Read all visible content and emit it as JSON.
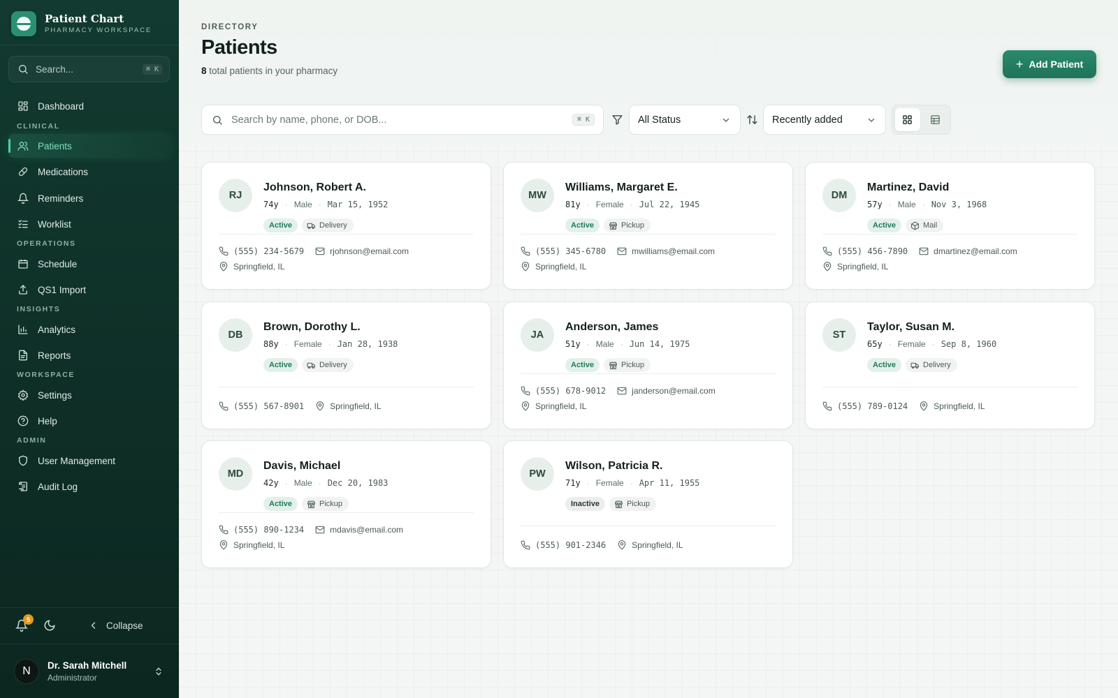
{
  "brand": {
    "title": "Patient Chart",
    "subtitle": "PHARMACY WORKSPACE"
  },
  "sidebar": {
    "search_placeholder": "Search...",
    "search_shortcut": "⌘ K",
    "sections": {
      "clinical": "CLINICAL",
      "operations": "OPERATIONS",
      "insights": "INSIGHTS",
      "workspace": "WORKSPACE",
      "admin": "ADMIN"
    },
    "items": {
      "dashboard": "Dashboard",
      "patients": "Patients",
      "medications": "Medications",
      "reminders": "Reminders",
      "worklist": "Worklist",
      "schedule": "Schedule",
      "qs1_import": "QS1 Import",
      "analytics": "Analytics",
      "reports": "Reports",
      "settings": "Settings",
      "help": "Help",
      "user_management": "User Management",
      "audit_log": "Audit Log"
    },
    "active_item": "patients",
    "notification_count": "5",
    "collapse_label": "Collapse",
    "user": {
      "initial": "N",
      "name": "Dr. Sarah Mitchell",
      "role": "Administrator"
    }
  },
  "header": {
    "eyebrow": "DIRECTORY",
    "title": "Patients",
    "count": "8",
    "subtitle_rest": " total patients in your pharmacy",
    "add_button": "Add Patient"
  },
  "toolbar": {
    "search_placeholder": "Search by name, phone, or DOB...",
    "search_shortcut": "⌘ K",
    "status_filter": "All Status",
    "sort": "Recently added",
    "view_mode": "grid"
  },
  "colors": {
    "accent": "#1f7a5c",
    "sidebar_bg": "#0f3028",
    "badge_notification": "#e59a1c"
  },
  "patients": [
    {
      "initials": "RJ",
      "name": "Johnson, Robert A.",
      "age": "74y",
      "sex": "Male",
      "dob": "Mar 15, 1952",
      "status": "Active",
      "mode": "Delivery",
      "mode_icon": "truck-icon",
      "phone": "(555) 234-5679",
      "email": "rjohnson@email.com",
      "location": "Springfield, IL"
    },
    {
      "initials": "MW",
      "name": "Williams, Margaret E.",
      "age": "81y",
      "sex": "Female",
      "dob": "Jul 22, 1945",
      "status": "Active",
      "mode": "Pickup",
      "mode_icon": "store-icon",
      "phone": "(555) 345-6780",
      "email": "mwilliams@email.com",
      "location": "Springfield, IL"
    },
    {
      "initials": "DM",
      "name": "Martinez, David",
      "age": "57y",
      "sex": "Male",
      "dob": "Nov 3, 1968",
      "status": "Active",
      "mode": "Mail",
      "mode_icon": "package-icon",
      "phone": "(555) 456-7890",
      "email": "dmartinez@email.com",
      "location": "Springfield, IL"
    },
    {
      "initials": "DB",
      "name": "Brown, Dorothy L.",
      "age": "88y",
      "sex": "Female",
      "dob": "Jan 28, 1938",
      "status": "Active",
      "mode": "Delivery",
      "mode_icon": "truck-icon",
      "phone": "(555) 567-8901",
      "email": "",
      "location": "Springfield, IL"
    },
    {
      "initials": "JA",
      "name": "Anderson, James",
      "age": "51y",
      "sex": "Male",
      "dob": "Jun 14, 1975",
      "status": "Active",
      "mode": "Pickup",
      "mode_icon": "store-icon",
      "phone": "(555) 678-9012",
      "email": "janderson@email.com",
      "location": "Springfield, IL"
    },
    {
      "initials": "ST",
      "name": "Taylor, Susan M.",
      "age": "65y",
      "sex": "Female",
      "dob": "Sep 8, 1960",
      "status": "Active",
      "mode": "Delivery",
      "mode_icon": "truck-icon",
      "phone": "(555) 789-0124",
      "email": "",
      "location": "Springfield, IL"
    },
    {
      "initials": "MD",
      "name": "Davis, Michael",
      "age": "42y",
      "sex": "Male",
      "dob": "Dec 20, 1983",
      "status": "Active",
      "mode": "Pickup",
      "mode_icon": "store-icon",
      "phone": "(555) 890-1234",
      "email": "mdavis@email.com",
      "location": "Springfield, IL"
    },
    {
      "initials": "PW",
      "name": "Wilson, Patricia R.",
      "age": "71y",
      "sex": "Female",
      "dob": "Apr 11, 1955",
      "status": "Inactive",
      "mode": "Pickup",
      "mode_icon": "store-icon",
      "phone": "(555) 901-2346",
      "email": "",
      "location": "Springfield, IL"
    }
  ]
}
